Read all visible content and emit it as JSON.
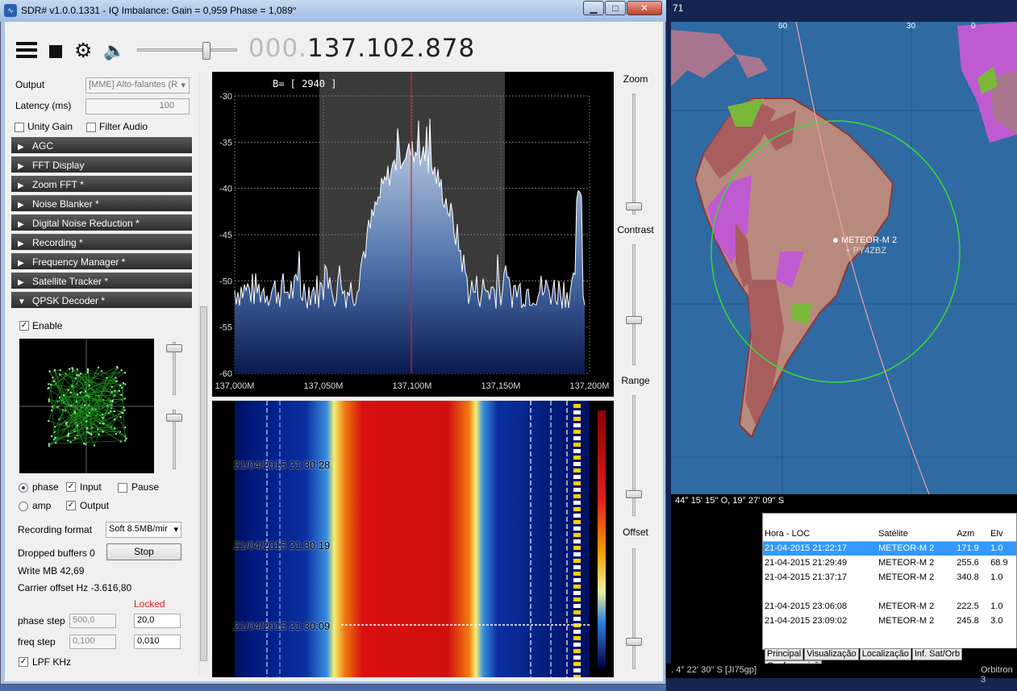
{
  "window": {
    "title": "SDR# v1.0.0.1331 - IQ Imbalance: Gain = 0,959 Phase = 1,089°",
    "btn_min": "▁",
    "btn_max": "□",
    "btn_close": "✕"
  },
  "toolbar": {
    "freq_dim": "000.",
    "freq_main": "137.102.878",
    "menu_icon": "hamburger-icon",
    "stop_icon": "stop-icon",
    "settings_icon": "gear-icon",
    "audio_icon": "speaker-icon",
    "volume_level": 0.7
  },
  "audio": {
    "output_label": "Output",
    "output_value": "[MME] Alto-falantes (R",
    "latency_label": "Latency (ms)",
    "latency_value": "100",
    "unity_gain": "Unity Gain",
    "filter_audio": "Filter Audio"
  },
  "panels": [
    "AGC",
    "FFT Display",
    "Zoom FFT *",
    "Noise Blanker *",
    "Digital Noise Reduction *",
    "Recording *",
    "Frequency Manager *",
    "Satellite Tracker *",
    "QPSK Decoder *"
  ],
  "qpsk": {
    "enable": "Enable",
    "phase": "phase",
    "amp": "amp",
    "input": "Input",
    "output": "Output",
    "pause": "Pause",
    "rec_format_label": "Recording format",
    "rec_format_value": "Soft 8.5MB/mir",
    "dropped": "Dropped buffers 0",
    "stop": "Stop",
    "write": "Write MB 42,69",
    "carrier": "Carrier offset Hz -3.616,80",
    "locked": "Locked",
    "phase_step": "phase step",
    "phase_step_a": "500,0",
    "phase_step_b": "20,0",
    "freq_step": "freq step",
    "freq_step_a": "0,100",
    "freq_step_b": "0,010",
    "lpf": "LPF KHz"
  },
  "spectrum": {
    "bw_label": "B= [ 2940 ]",
    "y_ticks": [
      "-30",
      "-35",
      "-40",
      "-45",
      "-50",
      "-55",
      "-60"
    ],
    "x_ticks": [
      "137,000M",
      "137,050M",
      "137,100M",
      "137,150M",
      "137,200M"
    ]
  },
  "waterfall": {
    "timestamps": [
      "21/04/2015 21:30:28",
      "21/04/2015 21:30:19",
      "21/04/2015 21:30:09"
    ]
  },
  "sliders": {
    "zoom": "Zoom",
    "contrast": "Contrast",
    "range": "Range",
    "offset": "Offset"
  },
  "map": {
    "top_labels": [
      "60",
      "30",
      "0"
    ],
    "title_frag": "71",
    "sat_name": "METEOR-M 2",
    "station": "+ PY4ZBZ",
    "coords": "44° 15' 15'' O, 19° 27' 09'' S",
    "status_left": ". 4° 22' 30'' S [JI75gp]",
    "status_right": "Orbitron 3"
  },
  "passes": {
    "headers": [
      "Hora - LOC",
      "Satélite",
      "Azm",
      "Elv"
    ],
    "rows": [
      [
        "21-04-2015 21:22:17",
        "METEOR-M 2",
        "171.9",
        "1.0"
      ],
      [
        "21-04-2015 21:29:49",
        "METEOR-M 2",
        "255.6",
        "68.9"
      ],
      [
        "21-04-2015 21:37:17",
        "METEOR-M 2",
        "340.8",
        "1.0"
      ],
      [
        "",
        "",
        "",
        ""
      ],
      [
        "21-04-2015 23:06:08",
        "METEOR-M 2",
        "222.5",
        "1.0"
      ],
      [
        "21-04-2015 23:09:02",
        "METEOR-M 2",
        "245.8",
        "3.0"
      ]
    ]
  },
  "map_tabs": [
    "Principal",
    "Visualização",
    "Localização",
    "Inf. Sat/Orb",
    "Conf. previsõ"
  ]
}
